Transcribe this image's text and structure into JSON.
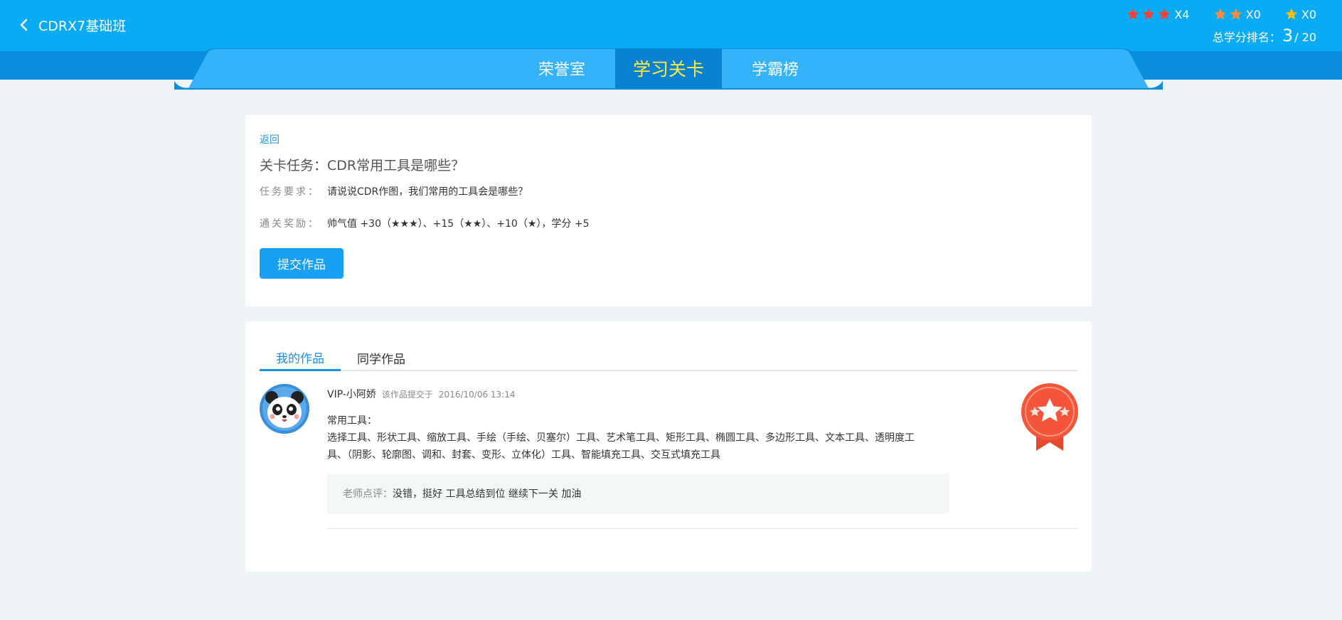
{
  "header": {
    "course_title": "CDRX7基础班",
    "stars": [
      {
        "stars": 3,
        "count": "X4",
        "color": "#f44336"
      },
      {
        "stars": 2,
        "count": "X0",
        "color": "#ff8a3d"
      },
      {
        "stars": 1,
        "count": "X0",
        "color": "#ffc107"
      }
    ],
    "rank_label": "总学分排名：",
    "rank_current": "3",
    "rank_separator": "/",
    "rank_total": "20"
  },
  "tabs": [
    {
      "label": "荣誉室",
      "active": false
    },
    {
      "label": "学习关卡",
      "active": true
    },
    {
      "label": "学霸榜",
      "active": false
    }
  ],
  "task": {
    "return_label": "返回",
    "title": "关卡任务：CDR常用工具是哪些？",
    "requirement_label": "任务要求：",
    "requirement_text": "请说说CDR作图，我们常用的工具会是哪些？",
    "reward_label": "通关奖励：",
    "reward_text": "帅气值 +30（★★★）、+15（★★）、+10（★），学分 +5",
    "submit_label": "提交作品"
  },
  "works": {
    "tabs": [
      {
        "label": "我的作品",
        "active": true
      },
      {
        "label": "同学作品",
        "active": false
      }
    ],
    "entry": {
      "user_name": "VIP-小阿娇",
      "submit_note": "该作品提交于",
      "submit_time": "2016/10/06 13:14",
      "content_title": "常用工具：",
      "content_line1": "选择工具、形状工具、缩放工具、手绘（手绘、贝塞尔）工具、艺术笔工具、矩形工具、椭圆工具、多边形工具、文本工具、透明度工",
      "content_line2": "具、（阴影、轮廓图、调和、封套、变形、立体化）工具、智能填充工具、交互式填充工具",
      "comment_label": "老师点评：",
      "comment_text": "没错，挺好 工具总结到位 继续下一关 加油"
    }
  },
  "colors": {
    "header_bg": "#0aabf5",
    "band_bg": "#0a8fdf",
    "active_tab_bg": "#0a82d3",
    "active_tab_text": "#ffeb3b",
    "accent": "#1aa0f3",
    "medal": "#f4553a"
  },
  "icons": {
    "back": "chevron-left-icon",
    "avatar": "panda-avatar",
    "medal": "star-medal-icon"
  }
}
